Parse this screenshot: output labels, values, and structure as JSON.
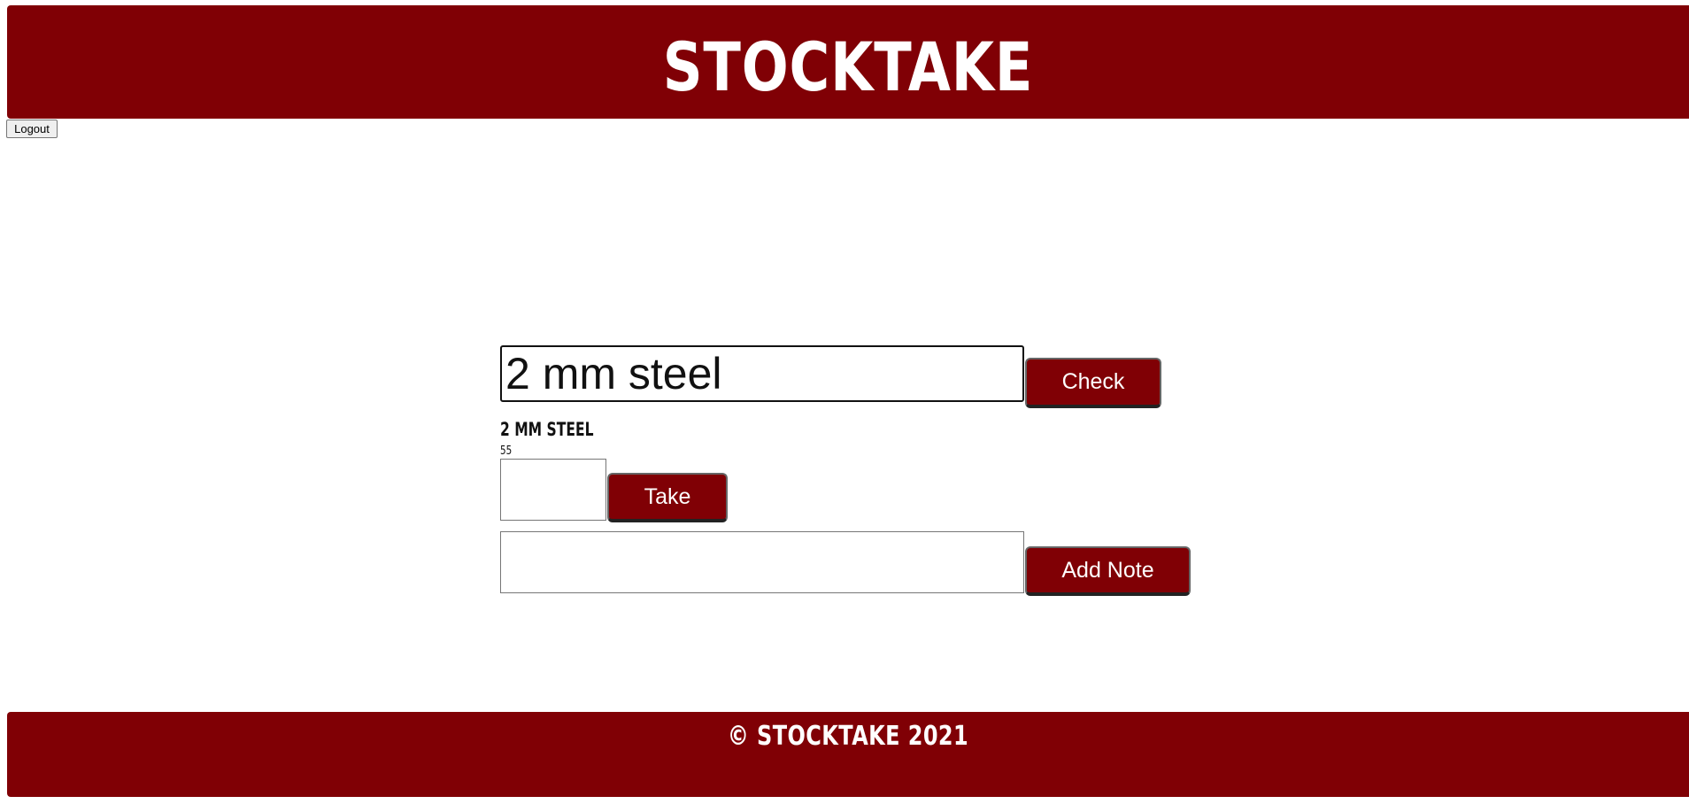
{
  "header": {
    "title": "STOCKTAKE"
  },
  "auth": {
    "logout_label": "Logout"
  },
  "search": {
    "value": "2 mm steel",
    "check_label": "Check"
  },
  "item": {
    "name": "2 MM STEEL",
    "quantity": "55"
  },
  "take": {
    "value": "",
    "button_label": "Take"
  },
  "note": {
    "value": "",
    "button_label": "Add Note"
  },
  "footer": {
    "text": "© STOCKTAKE 2021"
  },
  "colors": {
    "brand": "#800005",
    "text_on_brand": "#ffffff"
  }
}
